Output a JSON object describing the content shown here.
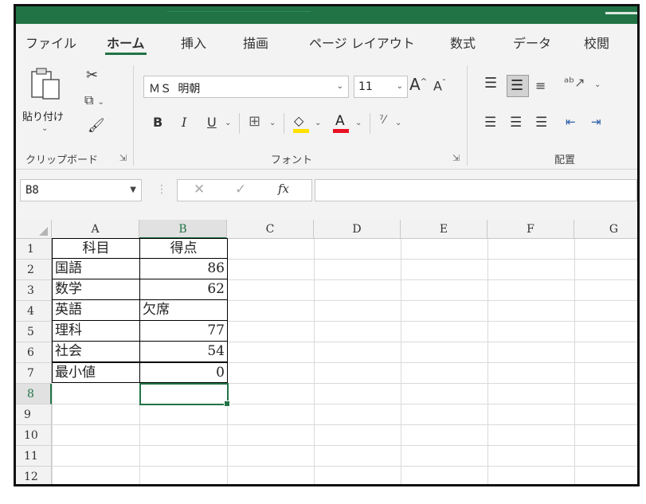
{
  "ribbon_tabs": [
    "ファイル",
    "ホーム",
    "挿入",
    "描画",
    "ページ レイアウト",
    "数式",
    "データ",
    "校閲"
  ],
  "active_tab": "ホーム",
  "clipboard": {
    "paste_label": "貼り付け",
    "group_label": "クリップボード"
  },
  "font": {
    "name": "ＭＳ 明朝",
    "size": "11",
    "group_label": "フォント",
    "grow_label": "A",
    "shrink_label": "A",
    "bold": "B",
    "italic": "I",
    "underline": "U",
    "font_color_glyph": "A"
  },
  "alignment": {
    "group_label": "配置"
  },
  "formula_bar": {
    "name_box": "B8",
    "fx_label": "fx",
    "formula": ""
  },
  "columns": [
    "A",
    "B",
    "C",
    "D",
    "E",
    "F",
    "G"
  ],
  "selected_column": "B",
  "rows": [
    "1",
    "2",
    "3",
    "4",
    "5",
    "6",
    "7",
    "8",
    "9",
    "10",
    "11",
    "12"
  ],
  "selected_row": "8",
  "table": {
    "headers": [
      "科目",
      "得点"
    ],
    "records": [
      {
        "subject": "国語",
        "score": "86"
      },
      {
        "subject": "数学",
        "score": "62"
      },
      {
        "subject": "英語",
        "score": "欠席"
      },
      {
        "subject": "理科",
        "score": "77"
      },
      {
        "subject": "社会",
        "score": "54"
      },
      {
        "subject": "最小値",
        "score": "0"
      }
    ]
  },
  "colors": {
    "accent": "#217346",
    "font_color_bar": "#e81123",
    "highlight_bar": "#ffe000"
  }
}
